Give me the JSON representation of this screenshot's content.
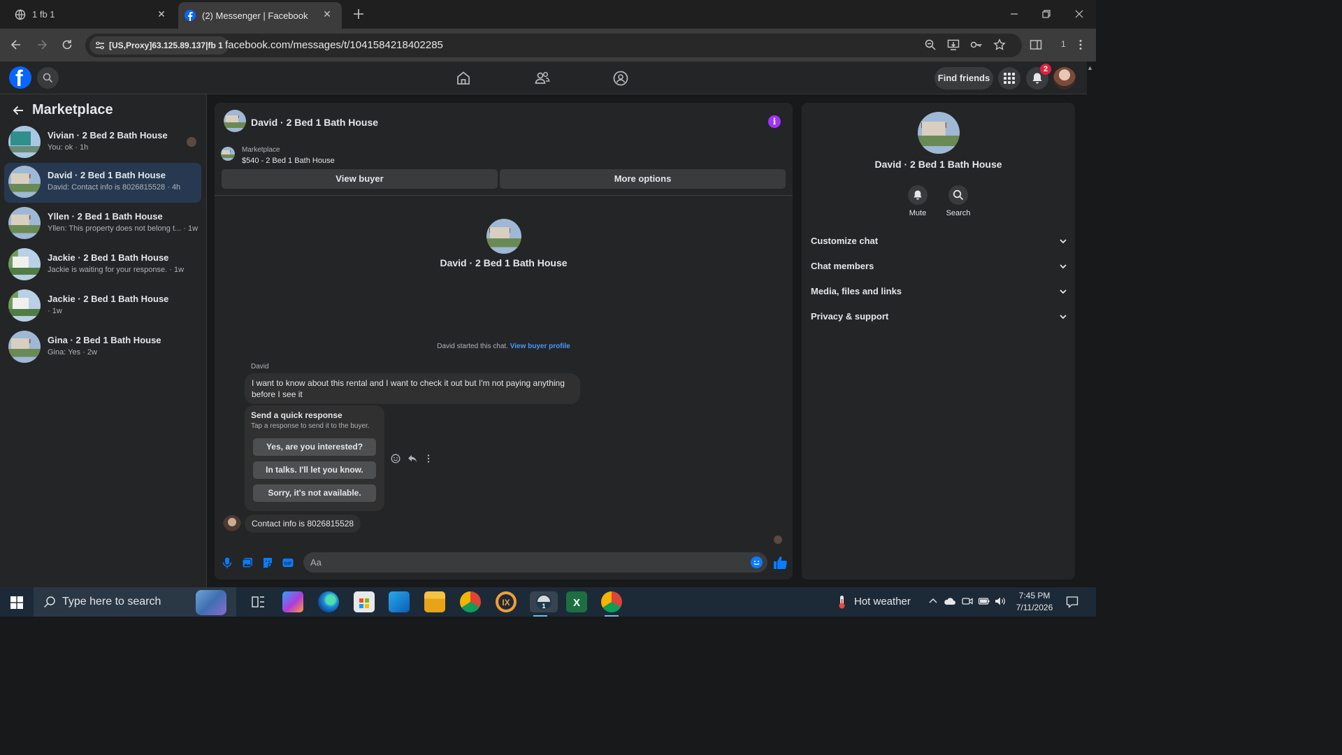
{
  "browser": {
    "tabs": [
      {
        "title": "1 fb 1",
        "icon": "globe-icon"
      },
      {
        "title": "(2) Messenger | Facebook",
        "icon": "facebook-icon"
      }
    ],
    "proxy_chip": "[US,Proxy]63.125.89.137|fb 1",
    "url": "facebook.com/messages/t/1041584218402285",
    "profile_count": "1"
  },
  "fb": {
    "logo_letter": "f",
    "find_friends": "Find friends",
    "notification_count": "2"
  },
  "left": {
    "title": "Marketplace",
    "conversations": [
      {
        "name": "Vivian · 2 Bed 2 Bath House",
        "snippet": "You: ok · 1h"
      },
      {
        "name": "David · 2 Bed 1 Bath House",
        "snippet": "David: Contact info is 8026815528 · 4h",
        "active": true
      },
      {
        "name": "Yllen · 2 Bed 1 Bath House",
        "snippet": "Yllen: This property does not belong t... · 1w"
      },
      {
        "name": "Jackie · 2 Bed 1 Bath House",
        "snippet": "Jackie is waiting for your response. · 1w"
      },
      {
        "name": "Jackie · 2 Bed 1 Bath House",
        "snippet": "· 1w"
      },
      {
        "name": "Gina · 2 Bed 1 Bath House",
        "snippet": "Gina: Yes · 2w"
      }
    ]
  },
  "chat": {
    "header_name": "David · 2 Bed 1 Bath House",
    "marketplace_label": "Marketplace",
    "listing": "$540 - 2 Bed 1 Bath House",
    "view_buyer": "View buyer",
    "more_options": "More options",
    "center_name": "David · 2 Bed 1 Bath House",
    "started_text": "David started this chat.",
    "view_buyer_profile": "View buyer profile",
    "sender_name": "David",
    "message_1": "I want to know about this rental and I want to check it out but I'm not paying anything before I see it",
    "quick_title": "Send a quick response",
    "quick_subtitle": "Tap a response to send it to the buyer.",
    "quick_responses": [
      "Yes, are you interested?",
      "In talks. I'll let you know.",
      "Sorry, it's not available."
    ],
    "message_2": "Contact info is 8026815528",
    "composer_placeholder": "Aa"
  },
  "right": {
    "name": "David · 2 Bed 1 Bath House",
    "mute": "Mute",
    "search": "Search",
    "sections": [
      "Customize chat",
      "Chat members",
      "Media, files and links",
      "Privacy & support"
    ]
  },
  "taskbar": {
    "search_placeholder": "Type here to search",
    "weather": "Hot weather",
    "time": "7:45 PM",
    "date": "7/11/2026"
  },
  "colors": {
    "accent": "#0a7cff",
    "fb_blue": "#0866ff",
    "active_row": "#263951",
    "badge": "#e41e3f"
  }
}
